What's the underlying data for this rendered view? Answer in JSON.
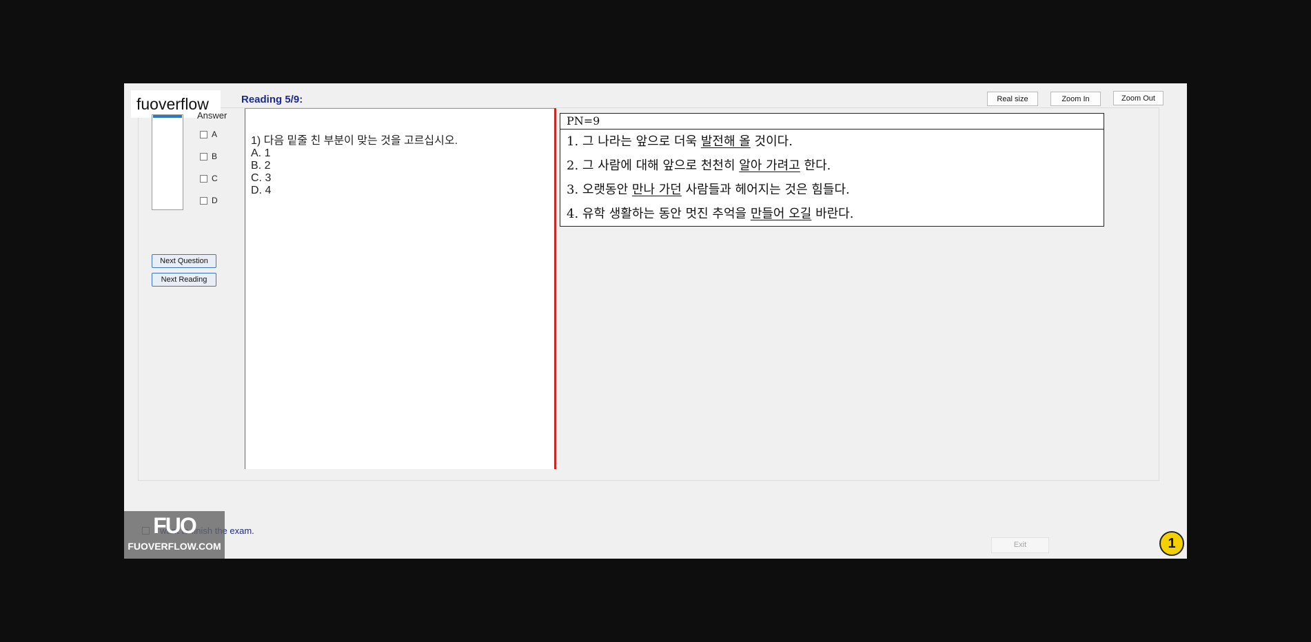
{
  "brand": "fuoverflow",
  "answer": {
    "label": "Answer",
    "options": [
      "A",
      "B",
      "C",
      "D"
    ]
  },
  "buttons": {
    "next_question": "Next Question",
    "next_reading": "Next Reading",
    "real_size": "Real size",
    "zoom_in": "Zoom In",
    "zoom_out": "Zoom Out",
    "exit": "Exit"
  },
  "reading_title": "Reading 5/9:",
  "question": {
    "stem": "1) 다음 밑줄 친 부분이 맞는 것을 고르십시오.",
    "choices": [
      "A. 1",
      "B. 2",
      "C. 3",
      "D. 4"
    ]
  },
  "passage": {
    "pn": "PN=9",
    "lines": [
      {
        "num": "1.",
        "before": "그 나라는 앞으로 더욱 ",
        "underline": "발전해 올",
        "after": " 것이다."
      },
      {
        "num": "2.",
        "before": "그 사람에 대해 앞으로 천천히 ",
        "underline": "알아 가려고",
        "after": " 한다."
      },
      {
        "num": "3.",
        "before": "오랫동안 ",
        "underline": "만나 가던",
        "after": " 사람들과 헤어지는 것은 힘들다."
      },
      {
        "num": "4.",
        "before": "유학 생활하는 동안 멋진 추억을 ",
        "underline": "만들어 오길",
        "after": " 바란다."
      }
    ]
  },
  "finish_label": "I want to finish the exam.",
  "badge": "1",
  "watermark": {
    "top": "FUO",
    "bottom": "FUOVERFLOW.COM"
  },
  "colors": {
    "accent": "#1b2a8c",
    "splitter": "#c92727",
    "badge": "#f3d100"
  }
}
